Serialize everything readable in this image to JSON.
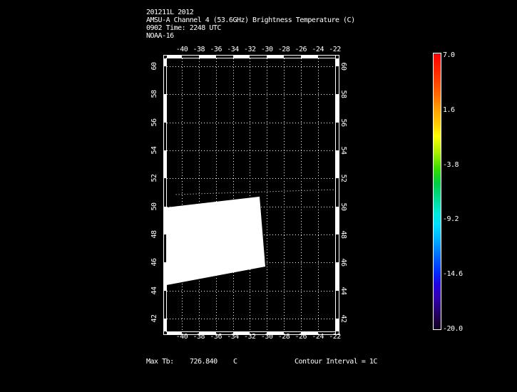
{
  "page": {
    "background": "#000000",
    "text_color": "#ffffff"
  },
  "header": {
    "line1": "201211L 2012",
    "line2": "AMSU-A Channel 4 (53.6GHz) Brightness Temperature (C)",
    "line3": "0902 Time: 2248 UTC",
    "line4": "NOAA-16"
  },
  "footer": {
    "max_tb_label": "Max Tb:",
    "max_tb_value": "726.840",
    "max_tb_unit": "C",
    "contour_interval": "Contour Interval = 1C"
  },
  "axes": {
    "x_tick_labels": [
      "-40",
      "-38",
      "-36",
      "-34",
      "-32",
      "-30",
      "-28",
      "-26",
      "-24",
      "-22"
    ],
    "y_tick_labels": [
      "60",
      "58",
      "56",
      "54",
      "52",
      "50",
      "48",
      "46",
      "44",
      "42"
    ],
    "x_ticks": [
      -40,
      -38,
      -36,
      -34,
      -32,
      -30,
      -28,
      -26,
      -24,
      -22
    ],
    "y_ticks": [
      60,
      58,
      56,
      54,
      52,
      50,
      48,
      46,
      44,
      42
    ]
  },
  "colorbar": {
    "max": 7.0,
    "min": -20.0,
    "tick_labels": [
      "7.0",
      "1.6",
      "-3.8",
      "-9.2",
      "-14.6",
      "-20.0"
    ],
    "tick_values": [
      7.0,
      1.6,
      -3.8,
      -9.2,
      -14.6,
      -20.0
    ],
    "border_color": "#ffffff",
    "gradient": [
      [
        0,
        "#ff0000"
      ],
      [
        8,
        "#ff3300"
      ],
      [
        15,
        "#ff6a00"
      ],
      [
        20,
        "#ff9d00"
      ],
      [
        26,
        "#ffd000"
      ],
      [
        30,
        "#fdff00"
      ],
      [
        36,
        "#a8f000"
      ],
      [
        42,
        "#35dc00"
      ],
      [
        47,
        "#00cc44"
      ],
      [
        53,
        "#00dd99"
      ],
      [
        58,
        "#00eadd"
      ],
      [
        62,
        "#00e0ff"
      ],
      [
        67,
        "#00b4ff"
      ],
      [
        73,
        "#0070ff"
      ],
      [
        79,
        "#0030ff"
      ],
      [
        84,
        "#2400dd"
      ],
      [
        89,
        "#3300aa"
      ],
      [
        94,
        "#260066"
      ],
      [
        100,
        "#10001f"
      ]
    ]
  },
  "chart_data": {
    "type": "heatmap",
    "title": "AMSU-A Channel 4 (53.6GHz) Brightness Temperature (C)",
    "subtitle": "201211L 2012 / 0902 Time: 2248 UTC / NOAA-16",
    "xlabel": "",
    "ylabel": "",
    "x_ticks": [
      -40,
      -38,
      -36,
      -34,
      -32,
      -30,
      -28,
      -26,
      -24,
      -22
    ],
    "y_ticks": [
      60,
      58,
      56,
      54,
      52,
      50,
      48,
      46,
      44,
      42
    ],
    "xlim": [
      -41.76,
      -21.96
    ],
    "ylim": [
      41.08,
      60.56
    ],
    "grid": "dotted",
    "legend_position": "right-colorbar",
    "colorbar_range": [
      -20.0,
      7.0
    ],
    "colorbar_tick_values": [
      7.0,
      1.6,
      -3.8,
      -9.2,
      -14.6,
      -20.0
    ],
    "swath": {
      "fill": "#ffffff",
      "note": "uniform saturated white swath region (no visible contour variation)",
      "polygon_lonlat": [
        [
          -41.76,
          49.93
        ],
        [
          -30.85,
          50.7
        ],
        [
          -30.18,
          45.71
        ],
        [
          -41.76,
          44.39
        ]
      ],
      "edge_line_lonlat": [
        [
          -40.7,
          50.85
        ],
        [
          -21.96,
          51.2
        ]
      ]
    },
    "max_tb_c": 726.84,
    "contour_interval_c": 1
  }
}
